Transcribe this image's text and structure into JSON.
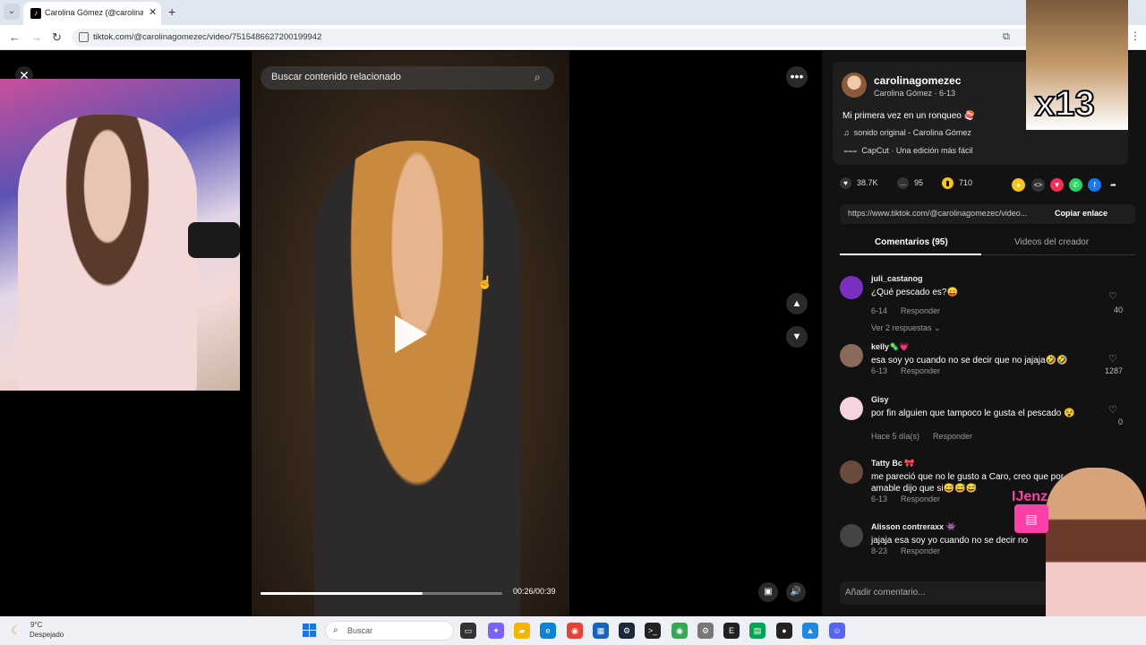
{
  "browser": {
    "tab_title": "Carolina Gómez (@carolinagomezec)",
    "url": "tiktok.com/@carolinagomezec/video/7515486627200199942"
  },
  "video": {
    "search_placeholder": "Buscar contenido relacionado",
    "time_readout": "00:26/00:39",
    "progress_fraction": 0.67
  },
  "creator": {
    "username": "carolinagomezec",
    "display_line": "Carolina Gómez · 6-13",
    "caption": "Mi primera vez en un ronqueo 🍣",
    "sound": "sonido original - Carolina Gómez",
    "capcut": "CapCut · Una edición más fácil"
  },
  "stats": {
    "likes": "38.7K",
    "comments": "95",
    "saves": "710"
  },
  "link": {
    "url": "https://www.tiktok.com/@carolinagomezec/video...",
    "copy_label": "Copiar enlace"
  },
  "tabs": {
    "comments": "Comentarios (95)",
    "creator_videos": "Videos del creador"
  },
  "comments": [
    {
      "user": "juli_castanog",
      "text": "¿Qué pescado es?😛",
      "date": "6-14",
      "reply": "Responder",
      "likes": "40",
      "more": "Ver 2 respuestas ⌄"
    },
    {
      "user": "kelly🦠💗",
      "text": "esa soy yo cuando no se decir que no jajaja🤣🤣",
      "date": "6-13",
      "reply": "Responder",
      "likes": "1287"
    },
    {
      "user": "Gisy",
      "text": "por fin alguien que tampoco le gusta el pescado 😵",
      "date": "Hace 5 día(s)",
      "reply": "Responder",
      "likes": "0"
    },
    {
      "user": "Tatty Bc 🎀",
      "text": "me pareció que no le gusto a Caro, creo que por ser amable dijo que si😅😅😅",
      "date": "6-13",
      "reply": "Responder",
      "likes": ""
    },
    {
      "user": "Alisson contreraxx 👾",
      "text": "jajaja esa soy yo cuando no se decir no",
      "date": "8-23",
      "reply": "Responder",
      "likes": ""
    }
  ],
  "comment_input": {
    "placeholder": "Añadir comentario..."
  },
  "overlay": {
    "meme_text": "x13",
    "streamer_tag": "IJenz"
  },
  "taskbar": {
    "temperature": "9°C",
    "weather": "Despejado",
    "search_label": "Buscar"
  }
}
